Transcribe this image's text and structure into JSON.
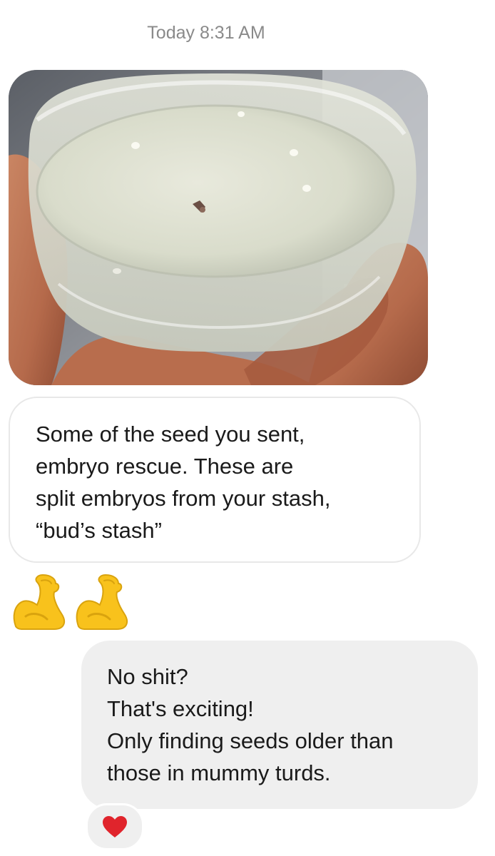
{
  "thread": {
    "timestamp": "Today 8:31 AM"
  },
  "messages": [
    {
      "type": "image",
      "sender": "received",
      "image_semantic": "photo-of-petri-dish-with-seed-embryos"
    },
    {
      "type": "text",
      "sender": "received",
      "lines": [
        "Some of the seed you sent,",
        "embryo rescue. These are",
        "split embryos from your stash,",
        "“bud’s stash”"
      ]
    },
    {
      "type": "emoji",
      "sender": "received",
      "emojis": [
        "flexed-biceps-icon",
        "flexed-biceps-icon"
      ]
    },
    {
      "type": "text",
      "sender": "sent",
      "lines": [
        "No shit?",
        "That's exciting!",
        "Only finding seeds older than",
        "those in mummy turds."
      ],
      "reaction": "red-heart-icon"
    }
  ],
  "colors": {
    "timestamp": "#8a8a8a",
    "received_bubble_border": "#e8e8e8",
    "sent_bubble_bg": "#efefef",
    "heart": "#e0242c",
    "emoji_yellow": "#f8c21c"
  }
}
